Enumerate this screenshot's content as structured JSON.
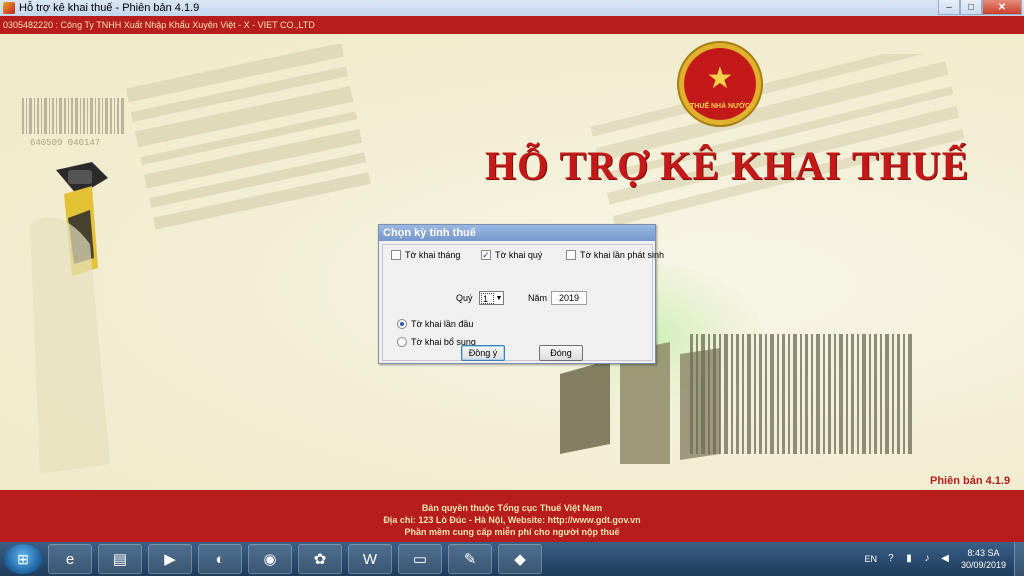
{
  "window": {
    "title": "Hỗ trợ kê khai thuế -  Phiên bản 4.1.9",
    "minimize": "–",
    "maximize": "□",
    "close": "✕"
  },
  "company_bar": "0305482220 : Công Ty TNHH Xuất Nhập Khẩu Xuyên Việt - X - VIET CO.,LTD",
  "emblem": {
    "text": "THUẾ NHÀ NƯỚC",
    "star": "★"
  },
  "main": {
    "title": "HỖ TRỢ KÊ KHAI THUẾ",
    "version": "Phiên bản 4.1.9",
    "barcode_number": "640509  040147"
  },
  "dialog": {
    "title": "Chọn kỳ tính thuế",
    "checkboxes": [
      {
        "label": "Tờ khai tháng",
        "checked": false
      },
      {
        "label": "Tờ khai quý",
        "checked": true
      },
      {
        "label": "Tờ khai lần phát sinh",
        "checked": false
      }
    ],
    "quarter_label": "Quý",
    "quarter_value": "1",
    "year_label": "Năm",
    "year_value": "2019",
    "radios": [
      {
        "label": "Tờ khai lần đầu",
        "selected": true
      },
      {
        "label": "Tờ khai bổ sung",
        "selected": false
      }
    ],
    "ok_label": "Đồng ý",
    "close_label": "Đóng"
  },
  "footer": {
    "line1": "Bản quyền thuộc Tổng cục Thuế Việt Nam",
    "line2": "Địa chỉ: 123 Lò Đúc - Hà Nội, Website: http://www.gdt.gov.vn",
    "line3": "Phần mềm cung cấp miễn phí cho người nộp thuế"
  },
  "taskbar": {
    "apps": [
      {
        "name": "internet-explorer-icon",
        "glyph": "e"
      },
      {
        "name": "file-explorer-icon",
        "glyph": "▤"
      },
      {
        "name": "media-player-icon",
        "glyph": "▶"
      },
      {
        "name": "coccoc-browser-icon",
        "glyph": "◐"
      },
      {
        "name": "chrome-icon",
        "glyph": "◉"
      },
      {
        "name": "picasa-icon",
        "glyph": "✿"
      },
      {
        "name": "word-icon",
        "glyph": "W"
      },
      {
        "name": "folder-icon",
        "glyph": "▭"
      },
      {
        "name": "paint-icon",
        "glyph": "✎"
      },
      {
        "name": "htkk-icon",
        "glyph": "◆"
      }
    ],
    "lang": "EN",
    "time": "8:43 SA",
    "date": "30/09/2019"
  },
  "colors": {
    "brand_red": "#b81d1d",
    "title_red": "#c41919",
    "footer_text": "#f4e3b0"
  }
}
